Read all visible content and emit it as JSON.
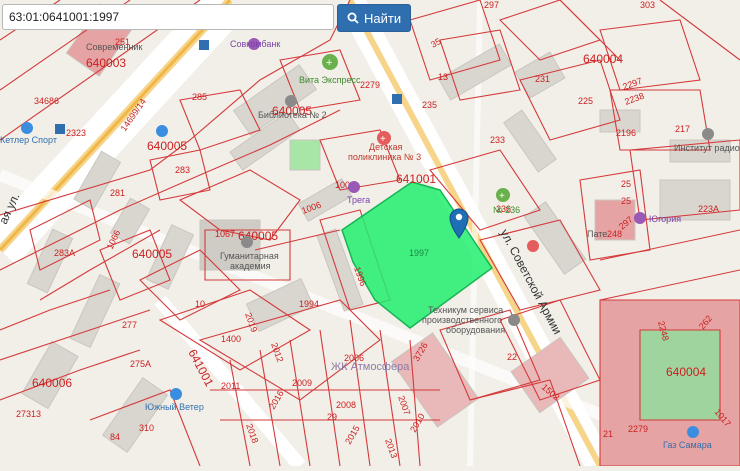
{
  "search": {
    "value": "63:01:0641001:1997",
    "button_label": "Найти"
  },
  "colors": {
    "selected_parcel": "#22ee6e",
    "cadastral_lines": "#d43a3a",
    "marker": "#1f6fb5"
  },
  "map": {
    "quarters": [
      "640003",
      "640005",
      "640005",
      "640005",
      "640006",
      "640004",
      "640004",
      "641001",
      "641001"
    ],
    "parcels": [
      "1997",
      "251",
      "285",
      "235",
      "231",
      "225",
      "2196",
      "217",
      "223A",
      "297",
      "303",
      "13",
      "2238",
      "2297",
      "2279",
      "233",
      "236",
      "1006",
      "1006",
      "1067",
      "1066",
      "283A",
      "281",
      "283",
      "277",
      "275A",
      "1400",
      "1994",
      "310",
      "2019",
      "2012",
      "2009",
      "2011",
      "2008",
      "2007",
      "2006",
      "2015",
      "2013",
      "2016",
      "2018",
      "29",
      "27313",
      "84",
      "2010",
      "1502",
      "3726",
      "2248",
      "262",
      "1017",
      "2279",
      "22",
      "21",
      "10",
      "1996",
      "34686",
      "2323",
      "14699/14",
      "25",
      "25",
      "248",
      "297",
      "35"
    ],
    "poi": {
      "sovkombank": "Совкомбанк",
      "vita": "Вита Экспресс",
      "library": "Библиотека № 2",
      "clinic_line1": "Детская",
      "clinic_line2": "поликлиника № 3",
      "pharmacy": "№ 236",
      "yugoriya": "Югория",
      "institut": "Институт радио",
      "academy_line1": "Гуманитарная",
      "academy_line2": "академия",
      "tech_line1": "Техникум сервиса",
      "tech_line2": "производственного",
      "tech_line3": "оборудования",
      "atmosfera": "ЖК Атмосфера",
      "yuzhny": "Южный Ветер",
      "kettler": "Кетлер Спорт",
      "sovremennik": "Современник",
      "gaz_sama": "Газ Самара",
      "patio": "Пате",
      "trega": "Трега"
    },
    "streets": {
      "sovetskoy_armii": "ул. Советской Армии",
      "left_street": "ая ул.",
      "number_2279": "2279"
    }
  }
}
